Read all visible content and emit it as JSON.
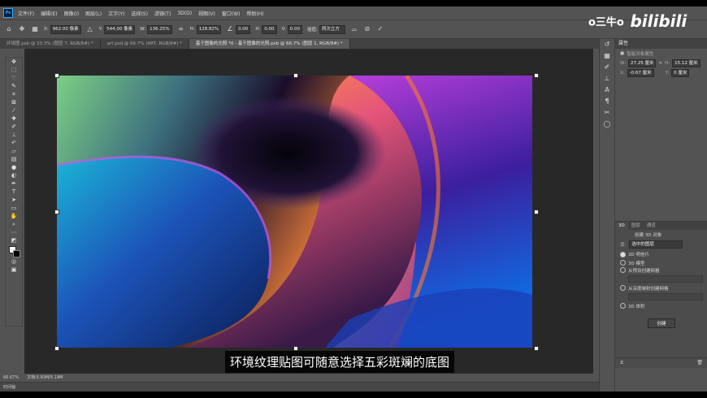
{
  "menu": {
    "items": [
      "文件(F)",
      "编辑(E)",
      "图像(I)",
      "图层(L)",
      "文字(Y)",
      "选择(S)",
      "滤镜(T)",
      "3D(D)",
      "视图(V)",
      "窗口(W)",
      "帮助(H)"
    ]
  },
  "options": {
    "x_label": "X:",
    "x_value": "962.00 像素",
    "y_label": "Y:",
    "y_value": "544.00 像素",
    "w_label": "W:",
    "w_value": "136.25%",
    "h_label": "H:",
    "h_value": "128.82%",
    "angle_value": "0.00",
    "hskew_label": "H:",
    "hskew_value": "0.00",
    "vskew_label": "V:",
    "vskew_value": "0.00",
    "interp_label": "插值:",
    "interp_value": "两次立方"
  },
  "tabs": [
    {
      "label": "环境图.psb @ 33.3% (图层 7, RGB/8#) *",
      "active": false
    },
    {
      "label": "art.psd @ 66.7% (ART, RGB/8#) *",
      "active": false
    },
    {
      "label": "基于图像的光照 *0 - 基于图像的光照.psb @ 66.7% (图层 1, RGB/8#) *",
      "active": true
    }
  ],
  "caption": "环境纹理贴图可随意选择五彩斑斓的底图",
  "status": {
    "zoom": "66.67%",
    "doc": "文档:5.93M/5.19M"
  },
  "timeline_label": "时间轴",
  "watermark": {
    "brand": "bilibili",
    "channel": "o三牛o"
  },
  "properties": {
    "title": "属性",
    "subtitle": "智能对象属性",
    "w_value": "27.25 厘米",
    "h_value": "15.12 厘米",
    "x_value": "-0.67 厘米",
    "y_value": "0 厘米"
  },
  "panel3d": {
    "tabs": [
      "3D",
      "图层",
      "通道"
    ],
    "header": "创建 3D 对象",
    "source_label": "源:",
    "source_value": "选中的图层",
    "options": [
      {
        "label": "3D 明信片",
        "selected": true
      },
      {
        "label": "3D 模型",
        "selected": false
      },
      {
        "label": "从预设创建网格",
        "selected": false
      },
      {
        "label": "从深度映射创建网格",
        "selected": false
      },
      {
        "label": "3D 体积",
        "selected": false
      }
    ],
    "create_button": "创建"
  },
  "colors": {
    "accent": "#31a8ff",
    "workspace": "#282828",
    "panel": "#535353"
  }
}
